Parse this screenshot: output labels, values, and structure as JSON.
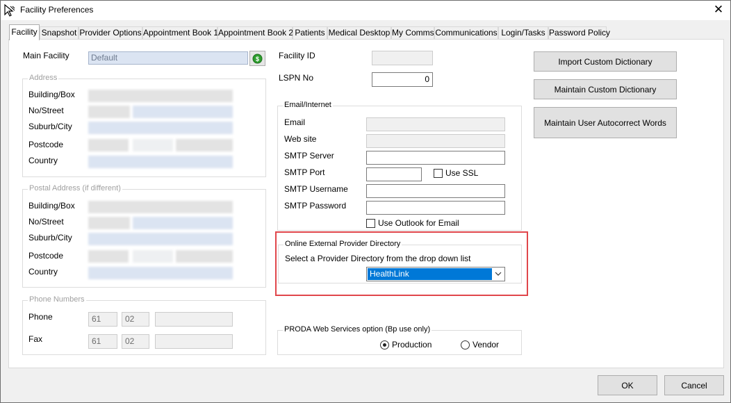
{
  "window": {
    "title": "Facility Preferences"
  },
  "tabs": [
    {
      "label": "Facility",
      "active": true
    },
    {
      "label": "Snapshot"
    },
    {
      "label": "Provider Options"
    },
    {
      "label": "Appointment Book 1"
    },
    {
      "label": "Appointment Book 2"
    },
    {
      "label": "Patients"
    },
    {
      "label": "Medical Desktop"
    },
    {
      "label": "My Comms"
    },
    {
      "label": "Communications"
    },
    {
      "label": "Login/Tasks"
    },
    {
      "label": "Password Policy"
    }
  ],
  "facility": {
    "main_facility_label": "Main Facility",
    "main_facility_value": "Default",
    "facility_id_label": "Facility ID",
    "lspn_label": "LSPN No",
    "lspn_value": "0"
  },
  "address": {
    "title": "Address",
    "building_label": "Building/Box",
    "street_label": "No/Street",
    "suburb_label": "Suburb/City",
    "postcode_label": "Postcode",
    "country_label": "Country"
  },
  "postal_address": {
    "title": "Postal Address (if different)",
    "building_label": "Building/Box",
    "street_label": "No/Street",
    "suburb_label": "Suburb/City",
    "postcode_label": "Postcode",
    "country_label": "Country"
  },
  "phone": {
    "title": "Phone Numbers",
    "phone_label": "Phone",
    "phone_country": "61",
    "phone_area": "02",
    "fax_label": "Fax",
    "fax_country": "61",
    "fax_area": "02"
  },
  "email": {
    "title": "Email/Internet",
    "email_label": "Email",
    "website_label": "Web site",
    "smtp_server_label": "SMTP Server",
    "smtp_port_label": "SMTP Port",
    "use_ssl_label": "Use SSL",
    "smtp_username_label": "SMTP Username",
    "smtp_password_label": "SMTP Password",
    "use_outlook_label": "Use Outlook for Email"
  },
  "provider_directory": {
    "title": "Online External Provider Directory",
    "instruction": "Select a Provider Directory from the drop down list",
    "selected": "HealthLink"
  },
  "proda": {
    "title": "PRODA Web Services option (Bp  use only)",
    "production_label": "Production",
    "vendor_label": "Vendor",
    "selected": "Production"
  },
  "buttons": {
    "import_dictionary": "Import Custom Dictionary",
    "maintain_dictionary": "Maintain Custom Dictionary",
    "maintain_autocorrect": "Maintain User Autocorrect Words",
    "ok": "OK",
    "cancel": "Cancel"
  },
  "colors": {
    "selection_blue": "#0078d7",
    "highlight_red": "#e0464b",
    "info_green": "#2e9e2e"
  }
}
